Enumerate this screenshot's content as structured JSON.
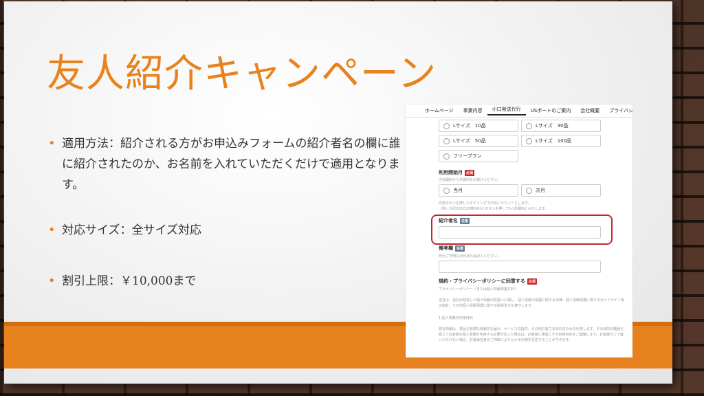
{
  "slide": {
    "title": "友人紹介キャンペーン",
    "bullets": [
      "適用方法：紹介される方がお申込みフォームの紹介者名の欄に誰に紹介されたのか、お名前を入れていただくだけで適用となります。",
      "対応サイズ：全サイズ対応",
      "割引上限：￥10,000まで"
    ],
    "accent_color": "#e8821e"
  },
  "screenshot": {
    "nav": [
      "ホームページ",
      "事業内容",
      "小口発送代行",
      "USポートのご案内",
      "会社概要",
      "プライバシーポリシー"
    ],
    "size_options": [
      "Lサイズ　10品",
      "Lサイズ　30品",
      "Lサイズ　50品",
      "Lサイズ　100品",
      "フリープラン"
    ],
    "start_month": {
      "label": "利用開始月",
      "required_badge": "必須",
      "hint": "当社開始から月開始をお選びください。",
      "options": [
        "当月",
        "次月"
      ],
      "note": "同意ボタンを押したタイミングでの月にカウントとします。\n（例）3月31日の23時59分にボタンを押しても3月開始とみなします。"
    },
    "referrer": {
      "label": "紹介者名",
      "optional_badge": "任意"
    },
    "remarks": {
      "label": "備考欄",
      "optional_badge": "任意",
      "hint": "何かご不明な点があれば記入ください。"
    },
    "policy": {
      "label": "規約・プライバシーポリシーに同意する",
      "required_badge": "必須",
      "subtitle": "プライバシーポリシー（または個人情報保護方針）",
      "para1": "当社は、当社が取得した個人情報の取扱いに関し、個人情報の保護に関する法律、個人情報保護に関するガイドライン等の指針、その他個人情報保護に関する関係法令を遵守します。",
      "heading": "1.個人情報の利用目的",
      "para2": "弊社情報は、標品を有償な情報のお届け、サービスの提供、その他お客さま目的のための利用します。その目的の範囲を超えてお客様の個人情報を利用する必要が生じた場合は、お客様に事前にその利用目的をご連絡します。お客様がご了解いただけない場合、お客様自身のご判断によりかかる利用を拒否することができます。"
    }
  }
}
